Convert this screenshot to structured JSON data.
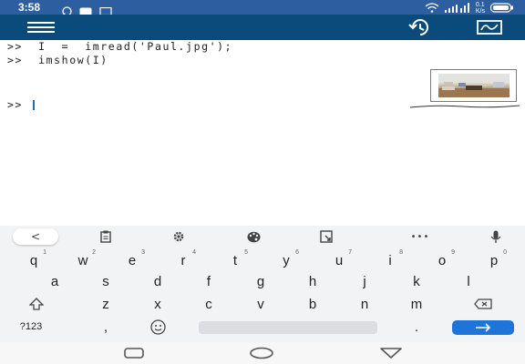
{
  "status_bar": {
    "time": "3:58",
    "network_speed_top": "0.1",
    "network_speed_bottom": "K/s"
  },
  "colors": {
    "status_bar_bg": "#2d5ea0",
    "app_bar_bg": "#0b4b7b",
    "enter_key_bg": "#1e74d9",
    "cursor": "#1a6fbf"
  },
  "console": {
    "lines": [
      ">>  I  =  imread('Paul.jpg');",
      ">>  imshow(I)"
    ],
    "prompt": ">> "
  },
  "figure_thumbnail": {
    "icon": "photo-thumbnail"
  },
  "keyboard": {
    "toolbar": [
      "back-icon",
      "clipboard-icon",
      "gear-icon",
      "palette-icon",
      "resize-icon",
      "more-icon",
      "mic-icon"
    ],
    "back_label": "<",
    "more_label": "•••",
    "row1": [
      {
        "k": "q",
        "s": "1"
      },
      {
        "k": "w",
        "s": "2"
      },
      {
        "k": "e",
        "s": "3"
      },
      {
        "k": "r",
        "s": "4"
      },
      {
        "k": "t",
        "s": "5"
      },
      {
        "k": "y",
        "s": "6"
      },
      {
        "k": "u",
        "s": "7"
      },
      {
        "k": "i",
        "s": "8"
      },
      {
        "k": "o",
        "s": "9"
      },
      {
        "k": "p",
        "s": "0"
      }
    ],
    "row2": [
      "a",
      "s",
      "d",
      "f",
      "g",
      "h",
      "j",
      "k",
      "l"
    ],
    "row3": [
      "z",
      "x",
      "c",
      "v",
      "b",
      "n",
      "m"
    ],
    "symbols_label": "?123",
    "comma_label": ",",
    "period_label": "."
  },
  "navbar": [
    "recent-apps-icon",
    "home-icon",
    "back-triangle-icon"
  ]
}
